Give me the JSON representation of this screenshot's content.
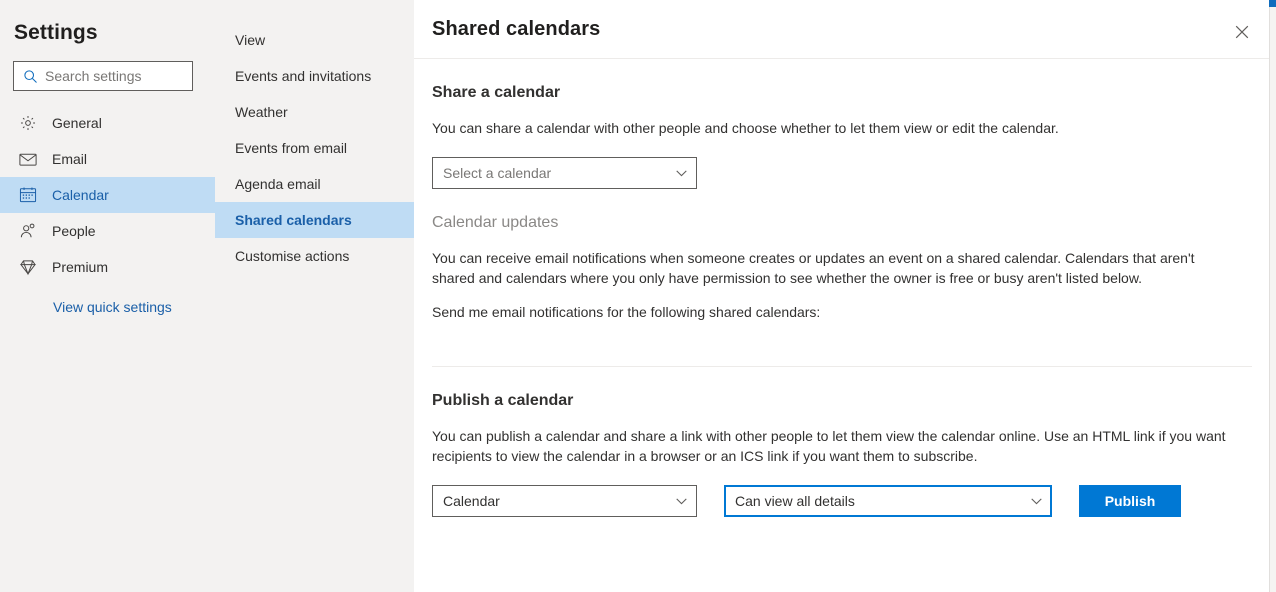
{
  "sidebar": {
    "title": "Settings",
    "search": {
      "icon": "search-icon",
      "placeholder": "Search settings",
      "value": ""
    },
    "items": [
      {
        "label": "General",
        "icon": "gear-icon",
        "selected": false
      },
      {
        "label": "Email",
        "icon": "envelope-icon",
        "selected": false
      },
      {
        "label": "Calendar",
        "icon": "calendar-icon",
        "selected": true
      },
      {
        "label": "People",
        "icon": "people-icon",
        "selected": false
      },
      {
        "label": "Premium",
        "icon": "diamond-icon",
        "selected": false
      }
    ],
    "quick_link": "View quick settings"
  },
  "subnav": {
    "items": [
      {
        "label": "View",
        "selected": false
      },
      {
        "label": "Events and invitations",
        "selected": false
      },
      {
        "label": "Weather",
        "selected": false
      },
      {
        "label": "Events from email",
        "selected": false
      },
      {
        "label": "Agenda email",
        "selected": false
      },
      {
        "label": "Shared calendars",
        "selected": true
      },
      {
        "label": "Customise actions",
        "selected": false
      }
    ]
  },
  "detail": {
    "title": "Shared calendars",
    "close_icon": "close-icon",
    "share_section": {
      "heading": "Share a calendar",
      "description": "You can share a calendar with other people and choose whether to let them view or edit the calendar.",
      "calendar_select": {
        "value": "Select a calendar",
        "is_placeholder": true
      }
    },
    "updates_section": {
      "heading": "Calendar updates",
      "description": "You can receive email notifications when someone creates or updates an event on a shared calendar. Calendars that aren't shared and calendars where you only have permission to see whether the owner is free or busy aren't listed below.",
      "notifications_label": "Send me email notifications for the following shared calendars:"
    },
    "publish_section": {
      "heading": "Publish a calendar",
      "description": "You can publish a calendar and share a link with other people to let them view the calendar online. Use an HTML link if you want recipients to view the calendar in a browser or an ICS link if you want them to subscribe.",
      "calendar_select": {
        "value": "Calendar"
      },
      "permission_select": {
        "value": "Can view all details",
        "focused": true
      },
      "publish_button": "Publish"
    }
  },
  "colors": {
    "accent": "#0078d4",
    "selected_row": "#bfdcf4",
    "selected_text": "#1a5fa8",
    "panel_bg": "#f3f2f1",
    "divider": "#edebe9",
    "muted_text": "#8a8886"
  }
}
